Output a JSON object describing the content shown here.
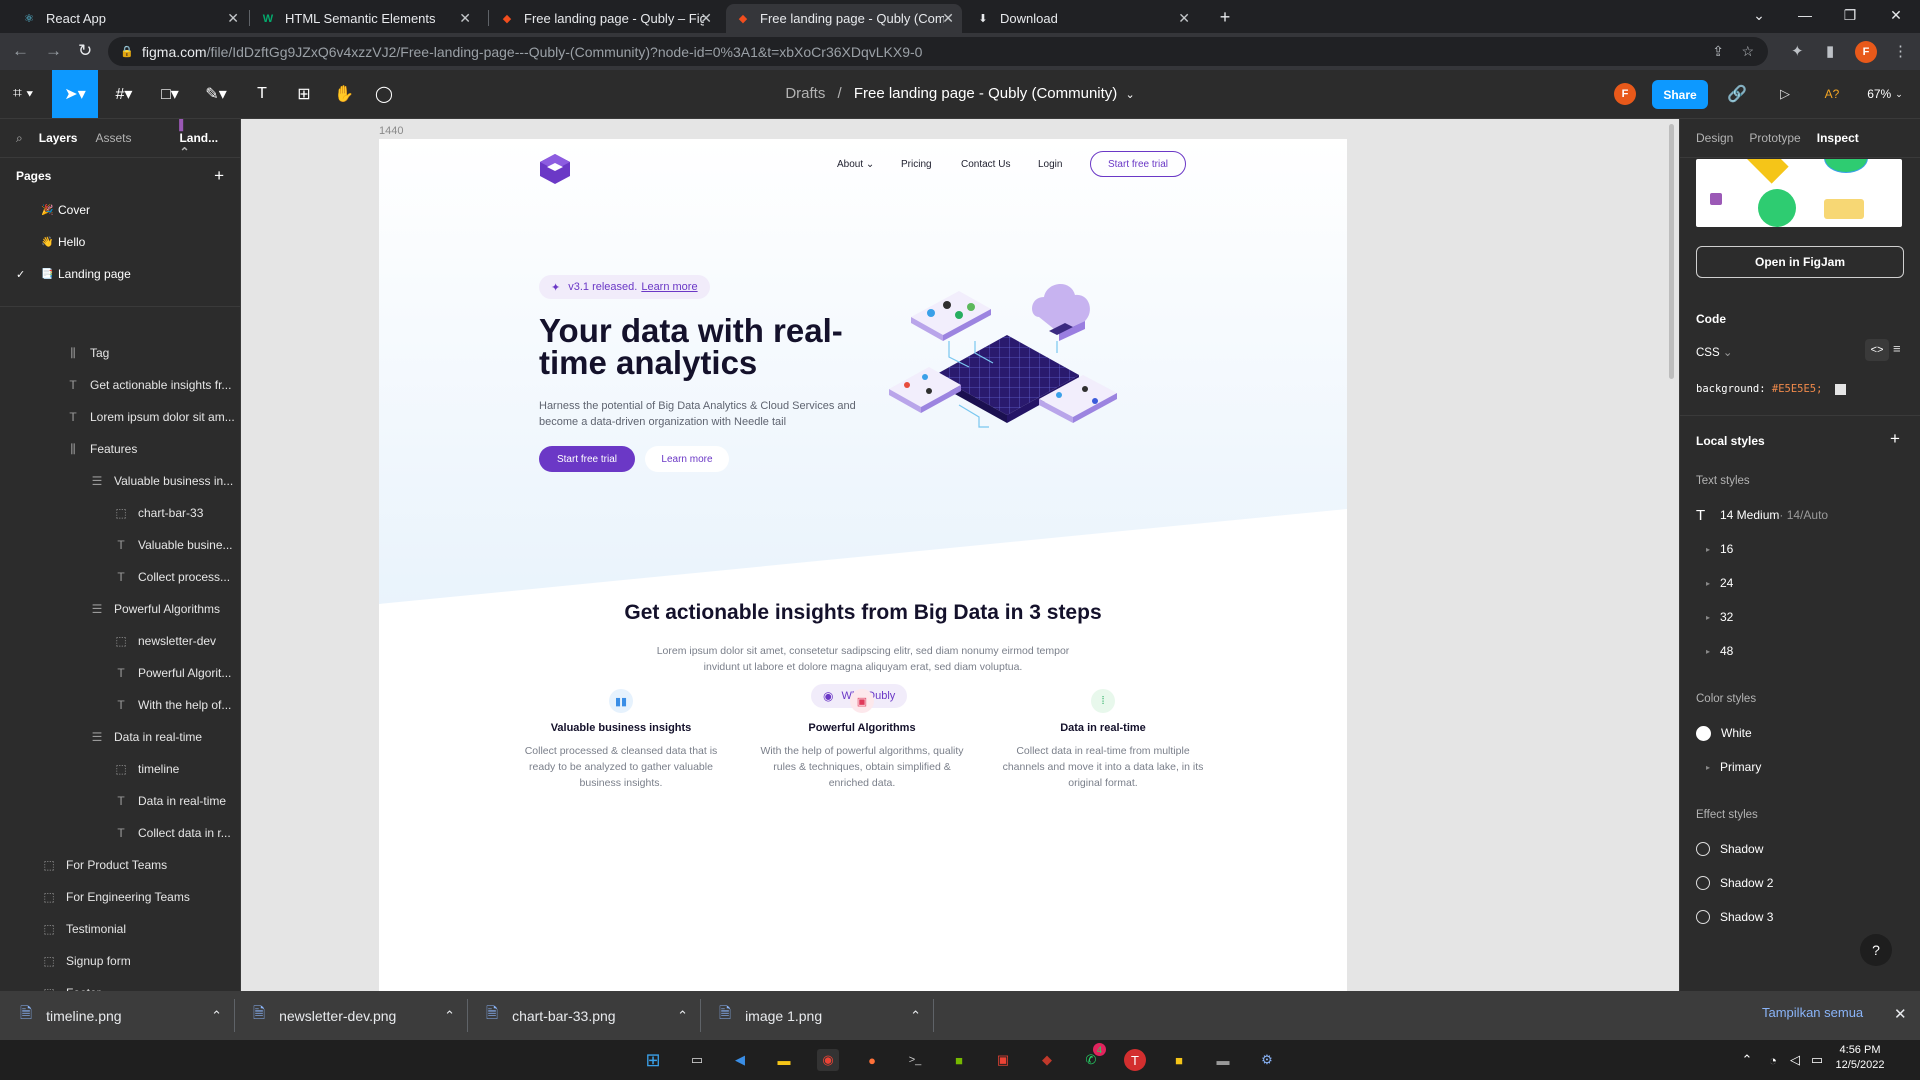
{
  "browser": {
    "tabs": [
      {
        "label": "React App"
      },
      {
        "label": "HTML Semantic Elements"
      },
      {
        "label": "Free landing page - Qubly – Figm"
      },
      {
        "label": "Free landing page - Qubly (Comm"
      },
      {
        "label": "Download"
      }
    ],
    "url_host": "figma.com",
    "url_path": "/file/IdDzftGg9JZxQ6v4xzzVJ2/Free-landing-page---Qubly-(Community)?node-id=0%3A1&t=xbXoCr36XDqvLKX9-0"
  },
  "figma": {
    "breadcrumb_drafts": "Drafts",
    "breadcrumb_sep": "/",
    "file_title": "Free landing page - Qubly (Community)",
    "share_label": "Share",
    "zoom": "67%",
    "avatar": "F"
  },
  "left": {
    "tabs": {
      "layers": "Layers",
      "assets": "Assets",
      "page": "Land..."
    },
    "pages_title": "Pages",
    "pages": [
      {
        "icon": "🎉",
        "label": "Cover"
      },
      {
        "icon": "👋",
        "label": "Hello"
      },
      {
        "icon": "📑",
        "label": "Landing page"
      }
    ],
    "layers": [
      {
        "label": "Tag",
        "indent": 1,
        "icon": "bars"
      },
      {
        "label": "Get actionable insights fr...",
        "indent": 1,
        "icon": "text"
      },
      {
        "label": "Lorem ipsum dolor sit am...",
        "indent": 1,
        "icon": "text"
      },
      {
        "label": "Features",
        "indent": 1,
        "icon": "bars"
      },
      {
        "label": "Valuable business in...",
        "indent": 2,
        "icon": "rows"
      },
      {
        "label": "chart-bar-33",
        "indent": 3,
        "icon": "frame"
      },
      {
        "label": "Valuable busine...",
        "indent": 3,
        "icon": "text"
      },
      {
        "label": "Collect process...",
        "indent": 3,
        "icon": "text"
      },
      {
        "label": "Powerful Algorithms",
        "indent": 2,
        "icon": "rows"
      },
      {
        "label": "newsletter-dev",
        "indent": 3,
        "icon": "frame"
      },
      {
        "label": "Powerful Algorit...",
        "indent": 3,
        "icon": "text"
      },
      {
        "label": "With the help of...",
        "indent": 3,
        "icon": "text"
      },
      {
        "label": "Data in real-time",
        "indent": 2,
        "icon": "rows"
      },
      {
        "label": "timeline",
        "indent": 3,
        "icon": "frame"
      },
      {
        "label": "Data in real-time",
        "indent": 3,
        "icon": "text"
      },
      {
        "label": "Collect data in r...",
        "indent": 3,
        "icon": "text"
      },
      {
        "label": "For Product Teams",
        "indent": 0,
        "icon": "frame"
      },
      {
        "label": "For Engineering Teams",
        "indent": 0,
        "icon": "frame"
      },
      {
        "label": "Testimonial",
        "indent": 0,
        "icon": "frame"
      },
      {
        "label": "Signup form",
        "indent": 0,
        "icon": "frame"
      },
      {
        "label": "Footer",
        "indent": 0,
        "icon": "frame"
      }
    ]
  },
  "canvas": {
    "frame_label": "1440",
    "nav": {
      "about": "About",
      "pricing": "Pricing",
      "contact": "Contact Us",
      "login": "Login",
      "cta": "Start free trial"
    },
    "hero": {
      "pill": "v3.1 released.",
      "pill_link": "Learn more",
      "title": "Your data with real-time analytics",
      "subtitle": "Harness the potential of Big Data Analytics & Cloud Services and become a data-driven organization with Needle tail",
      "primary_btn": "Start free trial",
      "secondary_btn": "Learn more"
    },
    "why": {
      "tag": "Why Qubly",
      "title": "Get actionable insights from Big Data in 3 steps",
      "text": "Lorem ipsum dolor sit amet, consetetur sadipscing elitr, sed diam nonumy eirmod tempor invidunt ut labore et dolore magna aliquyam erat, sed diam voluptua.",
      "features": [
        {
          "title": "Valuable business insights",
          "text": "Collect processed & cleansed data that is ready to be analyzed to gather valuable business insights."
        },
        {
          "title": "Powerful Algorithms",
          "text": "With the help of powerful algorithms, quality rules & techniques, obtain simplified & enriched data."
        },
        {
          "title": "Data in real-time",
          "text": "Collect data in real-time from multiple channels and move it into a data lake, in its original format."
        }
      ]
    }
  },
  "right": {
    "tabs": {
      "design": "Design",
      "prototype": "Prototype",
      "inspect": "Inspect"
    },
    "open_figjam": "Open in FigJam",
    "code_title": "Code",
    "code_lang": "CSS",
    "code_line_prop": "background:",
    "code_line_val": "#E5E5E5;",
    "local_styles": "Local styles",
    "text_styles": "Text styles",
    "text_style_first": "14 Medium",
    "text_style_first_meta": " · 14/Auto",
    "text_style_groups": [
      "16",
      "24",
      "32",
      "48"
    ],
    "color_styles": "Color styles",
    "color_white": "White",
    "color_primary": "Primary",
    "effect_styles": "Effect styles",
    "effects": [
      "Shadow",
      "Shadow 2",
      "Shadow 3"
    ],
    "help": "?"
  },
  "downloads": {
    "items": [
      "timeline.png",
      "newsletter-dev.png",
      "chart-bar-33.png",
      "image 1.png"
    ],
    "show_all": "Tampilkan semua"
  },
  "taskbar": {
    "time": "4:56 PM",
    "date": "12/5/2022",
    "badge": "4"
  },
  "colors": {
    "accent": "#0d99ff",
    "brand": "#6b38c6",
    "canvas_bg": "#E5E5E5"
  }
}
